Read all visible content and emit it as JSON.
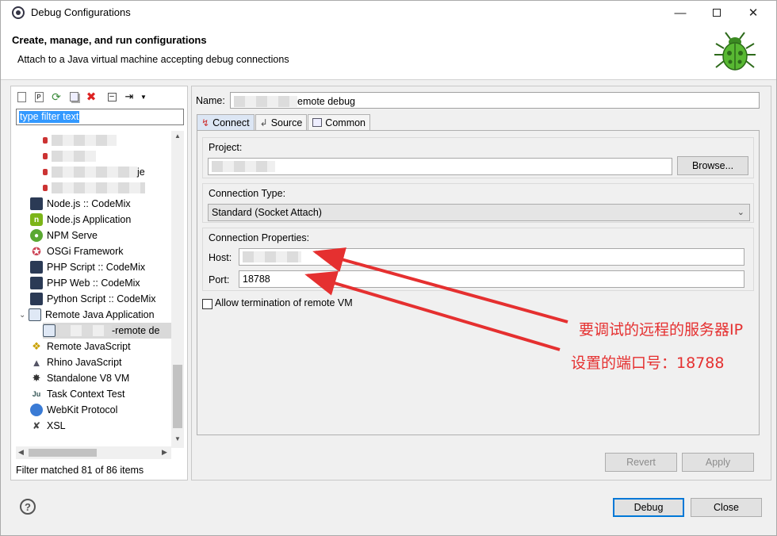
{
  "window": {
    "title": "Debug Configurations"
  },
  "header": {
    "title": "Create, manage, and run configurations",
    "description": "Attach to a Java virtual machine accepting debug connections"
  },
  "left": {
    "filter_placeholder": "type filter text",
    "tree": [
      {
        "label": "Node.js :: CodeMix",
        "icon": "monitor-icon"
      },
      {
        "label": "Node.js Application",
        "icon": "nodejs-icon"
      },
      {
        "label": "NPM Serve",
        "icon": "npm-icon"
      },
      {
        "label": "OSGi Framework",
        "icon": "osgi-icon"
      },
      {
        "label": "PHP Script :: CodeMix",
        "icon": "monitor-icon"
      },
      {
        "label": "PHP Web :: CodeMix",
        "icon": "monitor-icon"
      },
      {
        "label": "Python Script :: CodeMix",
        "icon": "monitor-icon"
      },
      {
        "label": "Remote Java Application",
        "icon": "remote-java-icon"
      },
      {
        "label": "-remote de",
        "icon": "config-icon"
      },
      {
        "label": "Remote JavaScript",
        "icon": "js-icon"
      },
      {
        "label": "Rhino JavaScript",
        "icon": "rhino-icon"
      },
      {
        "label": "Standalone V8 VM",
        "icon": "v8-icon"
      },
      {
        "label": "Task Context Test",
        "icon": "junit-icon"
      },
      {
        "label": "WebKit Protocol",
        "icon": "webkit-icon"
      },
      {
        "label": "XSL",
        "icon": "xsl-icon"
      }
    ],
    "partial_suffix": "je",
    "status": "Filter matched 81 of 86 items"
  },
  "right": {
    "name_label": "Name:",
    "name_value": "emote debug",
    "tabs": [
      {
        "label": "Connect",
        "icon": "connect-icon"
      },
      {
        "label": "Source",
        "icon": "source-icon"
      },
      {
        "label": "Common",
        "icon": "common-icon"
      }
    ],
    "project_label": "Project:",
    "browse_label": "Browse...",
    "connection_type_label": "Connection Type:",
    "connection_type_value": "Standard (Socket Attach)",
    "connection_props_label": "Connection Properties:",
    "host_label": "Host:",
    "port_label": "Port:",
    "port_value": "18788",
    "allow_termination_label": "Allow termination of remote VM",
    "revert_label": "Revert",
    "apply_label": "Apply"
  },
  "footer": {
    "debug_label": "Debug",
    "close_label": "Close"
  },
  "annotations": {
    "host_note": "要调试的远程的服务器IP",
    "port_note": "设置的端口号：18788",
    "color": "#e53030"
  }
}
